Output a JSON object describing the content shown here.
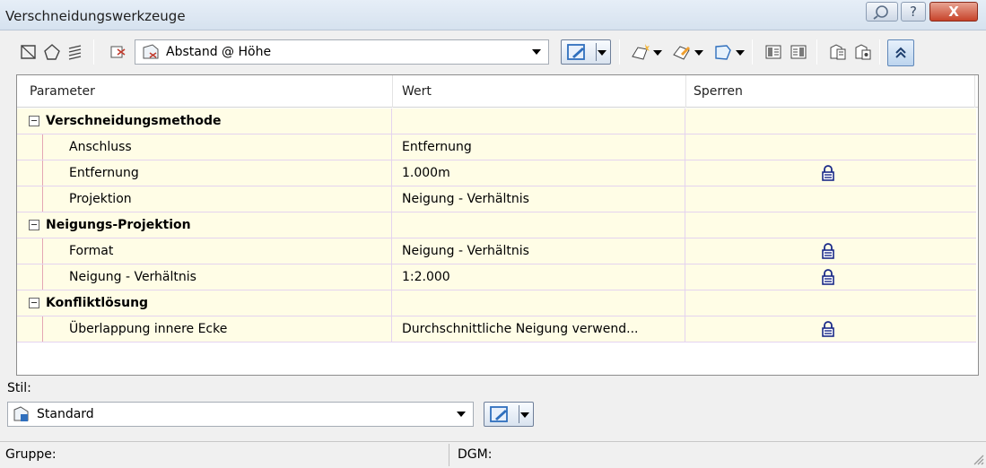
{
  "window": {
    "title": "Verschneidungswerkzeuge",
    "help_label": "?",
    "close_label": "X"
  },
  "toolbar": {
    "criteria_combo_value": "Abstand @ Höhe"
  },
  "grid": {
    "columns": [
      "Parameter",
      "Wert",
      "Sperren"
    ],
    "rows": [
      {
        "type": "category",
        "label": "Verschneidungsmethode",
        "value": "",
        "locked": false
      },
      {
        "type": "property",
        "label": "Anschluss",
        "value": "Entfernung",
        "locked": false
      },
      {
        "type": "property",
        "label": "Entfernung",
        "value": "1.000m",
        "locked": true
      },
      {
        "type": "property",
        "label": "Projektion",
        "value": "Neigung - Verhältnis",
        "locked": false
      },
      {
        "type": "category",
        "label": "Neigungs-Projektion",
        "value": "",
        "locked": false
      },
      {
        "type": "property",
        "label": "Format",
        "value": "Neigung - Verhältnis",
        "locked": true
      },
      {
        "type": "property",
        "label": "Neigung - Verhältnis",
        "value": "1:2.000",
        "locked": true
      },
      {
        "type": "category",
        "label": "Konfliktlösung",
        "value": "",
        "locked": false
      },
      {
        "type": "property",
        "label": "Überlappung innere Ecke",
        "value": "Durchschnittliche Neigung verwend...",
        "locked": true
      }
    ]
  },
  "style": {
    "label": "Stil:",
    "value": "Standard"
  },
  "status": {
    "group_label": "Gruppe:",
    "dgm_label": "DGM:"
  },
  "colors": {
    "row_background": "#fffde6",
    "row_divider": "#e4d3ef",
    "lock_icon": "#1a2a88",
    "accent_blue": "#2f6fbd"
  }
}
